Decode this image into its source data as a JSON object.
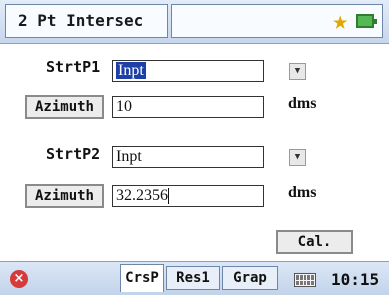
{
  "header": {
    "title": "2 Pt Intersec",
    "status_icons": [
      "star-icon",
      "battery-icon"
    ],
    "star_color": "#e0a800",
    "battery_color": "#2f7d2f"
  },
  "form": {
    "start_point_1": {
      "label": "StrtP1",
      "value": "Inpt"
    },
    "azimuth_1": {
      "button_label": "Azimuth",
      "value": "10",
      "unit": "dms"
    },
    "start_point_2": {
      "label": "StrtP2",
      "value": "Inpt"
    },
    "azimuth_2": {
      "button_label": "Azimuth",
      "value": "32.2356",
      "unit": "dms"
    },
    "calc_button": "Cal."
  },
  "footer": {
    "tabs": [
      {
        "label": "CrsP",
        "active": true
      },
      {
        "label": "Res1",
        "active": false
      },
      {
        "label": "Grap",
        "active": false
      }
    ],
    "time": "10:15",
    "icons": [
      "close-icon",
      "keyboard-icon"
    ],
    "close_color": "#d63a3a"
  }
}
